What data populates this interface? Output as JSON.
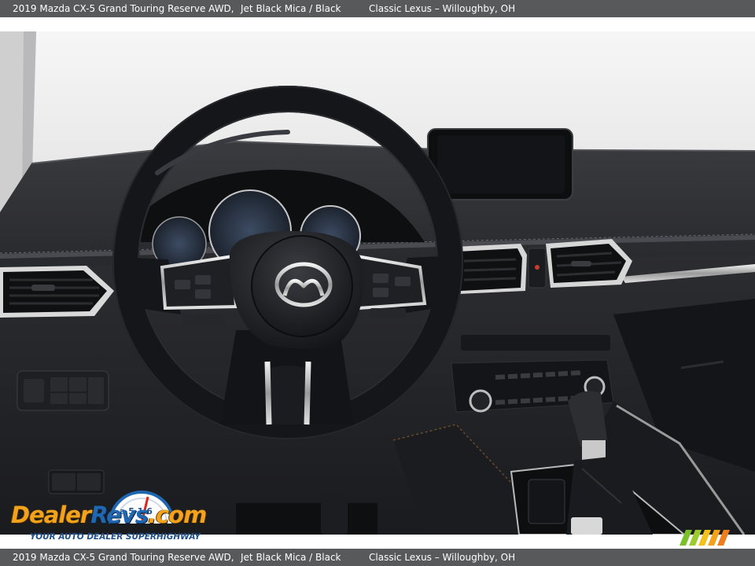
{
  "caption": {
    "vehicle": "2019 Mazda CX-5 Grand Touring Reserve AWD,",
    "color": "Jet Black Mica / Black",
    "dealer": "Classic Lexus – Willoughby, OH"
  },
  "watermark": {
    "brand_part1": "Dealer",
    "brand_part2": "Revs",
    "brand_suffix": ".com",
    "tagline": "YOUR AUTO DEALER SUPERHIGHWAY",
    "gauge_digits": "a 5 1 6"
  },
  "colors": {
    "caption_bg": "#58595b",
    "watermark_orange": "#f2a31b",
    "watermark_blue": "#1f67b1",
    "stripes_green": "#7bbf2a",
    "stripes_yellow": "#f3c11a",
    "stripes_orange": "#ee7d1e"
  },
  "photo": {
    "subject": "steering-wheel-and-dashboard",
    "emblem": "mazda-logo-icon"
  }
}
